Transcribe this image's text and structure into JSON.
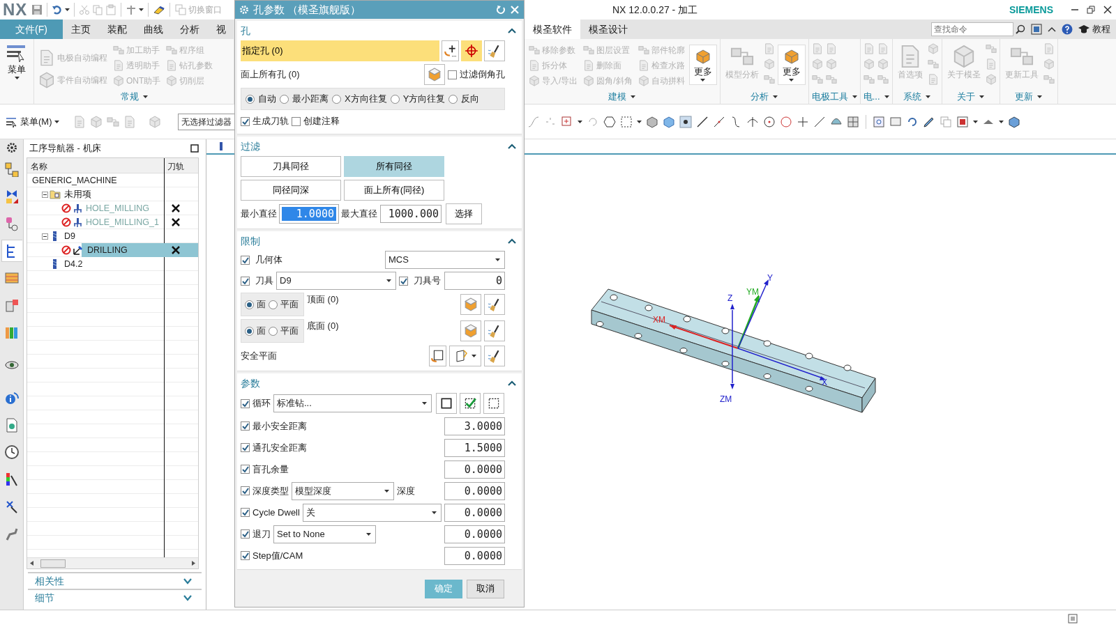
{
  "title_bar": {
    "logo": "NX",
    "switch_window": "切换窗口",
    "title": "NX 12.0.0.27 - 加工",
    "brand": "SIEMENS"
  },
  "ribbon": {
    "tabs_left": [
      {
        "label": "文件(F)",
        "kind": "file",
        "selected": false
      },
      {
        "label": "主页",
        "kind": "tab",
        "selected": false
      },
      {
        "label": "装配",
        "kind": "tab",
        "selected": false
      },
      {
        "label": "曲线",
        "kind": "tab",
        "selected": false
      },
      {
        "label": "分析",
        "kind": "tab",
        "selected": false
      },
      {
        "label": "视",
        "kind": "tab",
        "selected": false
      }
    ],
    "tabs_right": [
      {
        "label": "模圣软件",
        "kind": "tab",
        "selected": true
      },
      {
        "label": "模圣设计",
        "kind": "tab",
        "selected": false
      }
    ],
    "search": {
      "placeholder": "查找命令"
    },
    "help": "教程",
    "menu_button": "菜单",
    "groups_left": [
      {
        "label": "常规",
        "columns": [
          [
            {
              "label": "电极自动编程",
              "disabled": true
            },
            {
              "label": "零件自动编程",
              "disabled": true
            }
          ],
          [
            {
              "label": "加工助手",
              "disabled": true
            },
            {
              "label": "透明助手",
              "disabled": true
            },
            {
              "label": "ONT助手",
              "disabled": true
            }
          ],
          [
            {
              "label": "程序组",
              "disabled": true
            },
            {
              "label": "钻孔参数",
              "disabled": true
            },
            {
              "label": "切削层",
              "disabled": true
            }
          ]
        ]
      }
    ],
    "groups_right": [
      {
        "label": "建模",
        "columns": [
          [
            {
              "label": "移除参数",
              "disabled": true
            },
            {
              "label": "拆分体",
              "disabled": true
            },
            {
              "label": "导入/导出",
              "disabled": true
            }
          ],
          [
            {
              "label": "图层设置",
              "disabled": true
            },
            {
              "label": "删除面",
              "disabled": true
            },
            {
              "label": "圆角/斜角",
              "disabled": true
            }
          ],
          [
            {
              "label": "部件轮廓",
              "disabled": true
            },
            {
              "label": "检查水路",
              "disabled": true
            },
            {
              "label": "自动拼料",
              "disabled": true
            }
          ]
        ],
        "more": "更多"
      },
      {
        "label": "分析",
        "large": [
          {
            "label": "模型分析",
            "disabled": true
          }
        ],
        "more": "更多"
      },
      {
        "label": "电极工具"
      },
      {
        "label": "电..."
      },
      {
        "label": "系统",
        "large": [
          {
            "label": "首选项",
            "disabled": true
          }
        ]
      },
      {
        "label": "关于",
        "large": [
          {
            "label": "关于模圣",
            "disabled": true
          }
        ]
      },
      {
        "label": "更新",
        "large": [
          {
            "label": "更新工具",
            "disabled": true
          }
        ]
      }
    ]
  },
  "toolbar": {
    "menu_button": "菜单(M)",
    "filter": "无选择过滤器"
  },
  "resource_bar": [
    {
      "kind": "assembly",
      "selected": false
    },
    {
      "kind": "constraints",
      "selected": false
    },
    {
      "kind": "part",
      "selected": false
    },
    {
      "kind": "operations",
      "selected": true
    },
    {
      "kind": "library",
      "selected": false
    },
    {
      "kind": "hd3d",
      "selected": false
    },
    {
      "kind": "palette",
      "selected": false
    },
    {
      "kind": "visibility",
      "selected": false
    },
    {
      "kind": "info",
      "selected": false
    },
    {
      "kind": "web",
      "selected": false
    },
    {
      "kind": "history",
      "selected": false
    },
    {
      "kind": "color",
      "selected": false
    },
    {
      "kind": "machine",
      "selected": false
    },
    {
      "kind": "roles",
      "selected": false
    }
  ],
  "navigator": {
    "title": "工序导航器 - 机床",
    "columns": [
      "名称",
      "刀轨"
    ],
    "tree": [
      {
        "name": "GENERIC_MACHINE",
        "selected": false,
        "children": [
          {
            "name": "未用项",
            "kind": "folder",
            "selected": false,
            "expanded": true,
            "children": [
              {
                "name": "HOLE_MILLING",
                "kind": "mill_operation",
                "selected": false,
                "toolpath_missing": true
              },
              {
                "name": "HOLE_MILLING_1",
                "kind": "mill_operation",
                "selected": false,
                "toolpath_missing": true
              }
            ]
          },
          {
            "name": "D9",
            "kind": "tool",
            "selected": false,
            "expanded": true,
            "children": [
              {
                "name": "DRILLING",
                "kind": "drill_operation",
                "selected": true,
                "toolpath_missing": true
              }
            ]
          },
          {
            "name": "D4.2",
            "kind": "tool",
            "selected": false
          }
        ]
      }
    ],
    "panels": [
      {
        "label": "相关性",
        "expanded": false
      },
      {
        "label": "细节",
        "expanded": false
      }
    ]
  },
  "graphics": {
    "axis_labels": [
      "XM",
      "YM",
      "Y",
      "Z",
      "ZM",
      "X"
    ]
  },
  "dialog": {
    "title": "孔参数 （模圣旗舰版）",
    "hole": {
      "title": "孔",
      "expanded": true,
      "specify": {
        "label": "指定孔 (0)",
        "active": true
      },
      "face_holes": "面上所有孔 (0)",
      "filter_chamfer": {
        "label": "过滤倒角孔",
        "checked": false
      },
      "order": [
        {
          "label": "自动",
          "selected": true
        },
        {
          "label": "最小距离",
          "selected": false
        },
        {
          "label": "X方向往复",
          "selected": false
        },
        {
          "label": "Y方向往复",
          "selected": false
        },
        {
          "label": "反向",
          "selected": false
        }
      ],
      "options": [
        {
          "label": "生成刀轨",
          "checked": true
        },
        {
          "label": "创建注释",
          "checked": false
        }
      ]
    },
    "filter": {
      "title": "过滤",
      "expanded": true,
      "buttons": [
        {
          "label": "刀具同径",
          "selected": false
        },
        {
          "label": "所有同径",
          "selected": true
        },
        {
          "label": "同径同深",
          "selected": false
        },
        {
          "label": "面上所有(同径)",
          "selected": false
        }
      ],
      "min": {
        "label": "最小直径",
        "value": "1.0000",
        "highlighted": true
      },
      "max": {
        "label": "最大直径",
        "value": "1000.000",
        "highlighted": false
      },
      "select_button": "选择"
    },
    "limits": {
      "title": "限制",
      "expanded": true,
      "geometry": {
        "label": "几何体",
        "checked": true,
        "value": "MCS"
      },
      "tool": {
        "label": "刀具",
        "checked": true,
        "value": "D9"
      },
      "tool_number": {
        "label": "刀具号",
        "checked": true,
        "value": "0"
      },
      "faces": [
        {
          "options": [
            {
              "label": "面",
              "selected": true
            },
            {
              "label": "平面",
              "selected": false
            }
          ],
          "label": "顶面 (0)"
        },
        {
          "options": [
            {
              "label": "面",
              "selected": true
            },
            {
              "label": "平面",
              "selected": false
            }
          ],
          "label": "底面 (0)"
        }
      ],
      "safe_plane": "安全平面"
    },
    "parameters": {
      "title": "参数",
      "expanded": true,
      "cycle": {
        "label": "循环",
        "checked": true,
        "value": "标准钻..."
      },
      "rows": [
        {
          "kind": "value",
          "label": "最小安全距离",
          "checked": true,
          "value": "3.0000"
        },
        {
          "kind": "value",
          "label": "通孔安全距离",
          "checked": true,
          "value": "1.5000"
        },
        {
          "kind": "value",
          "label": "盲孔余量",
          "checked": true,
          "value": "0.0000"
        },
        {
          "kind": "dropdown",
          "label": "深度类型",
          "checked": true,
          "option": "模型深度",
          "unit": "深度",
          "value": "0.0000"
        },
        {
          "kind": "dropdown",
          "label": "Cycle Dwell",
          "checked": true,
          "option": "关",
          "value": "0.0000"
        },
        {
          "kind": "dropdown",
          "label": "退刀",
          "checked": true,
          "option": "Set to None",
          "value": "0.0000"
        },
        {
          "kind": "value",
          "label": "Step值/CAM",
          "checked": true,
          "value": "0.0000"
        }
      ]
    },
    "buttons": [
      {
        "label": "确定",
        "kind": "primary"
      },
      {
        "label": "取消",
        "kind": "secondary"
      }
    ]
  }
}
